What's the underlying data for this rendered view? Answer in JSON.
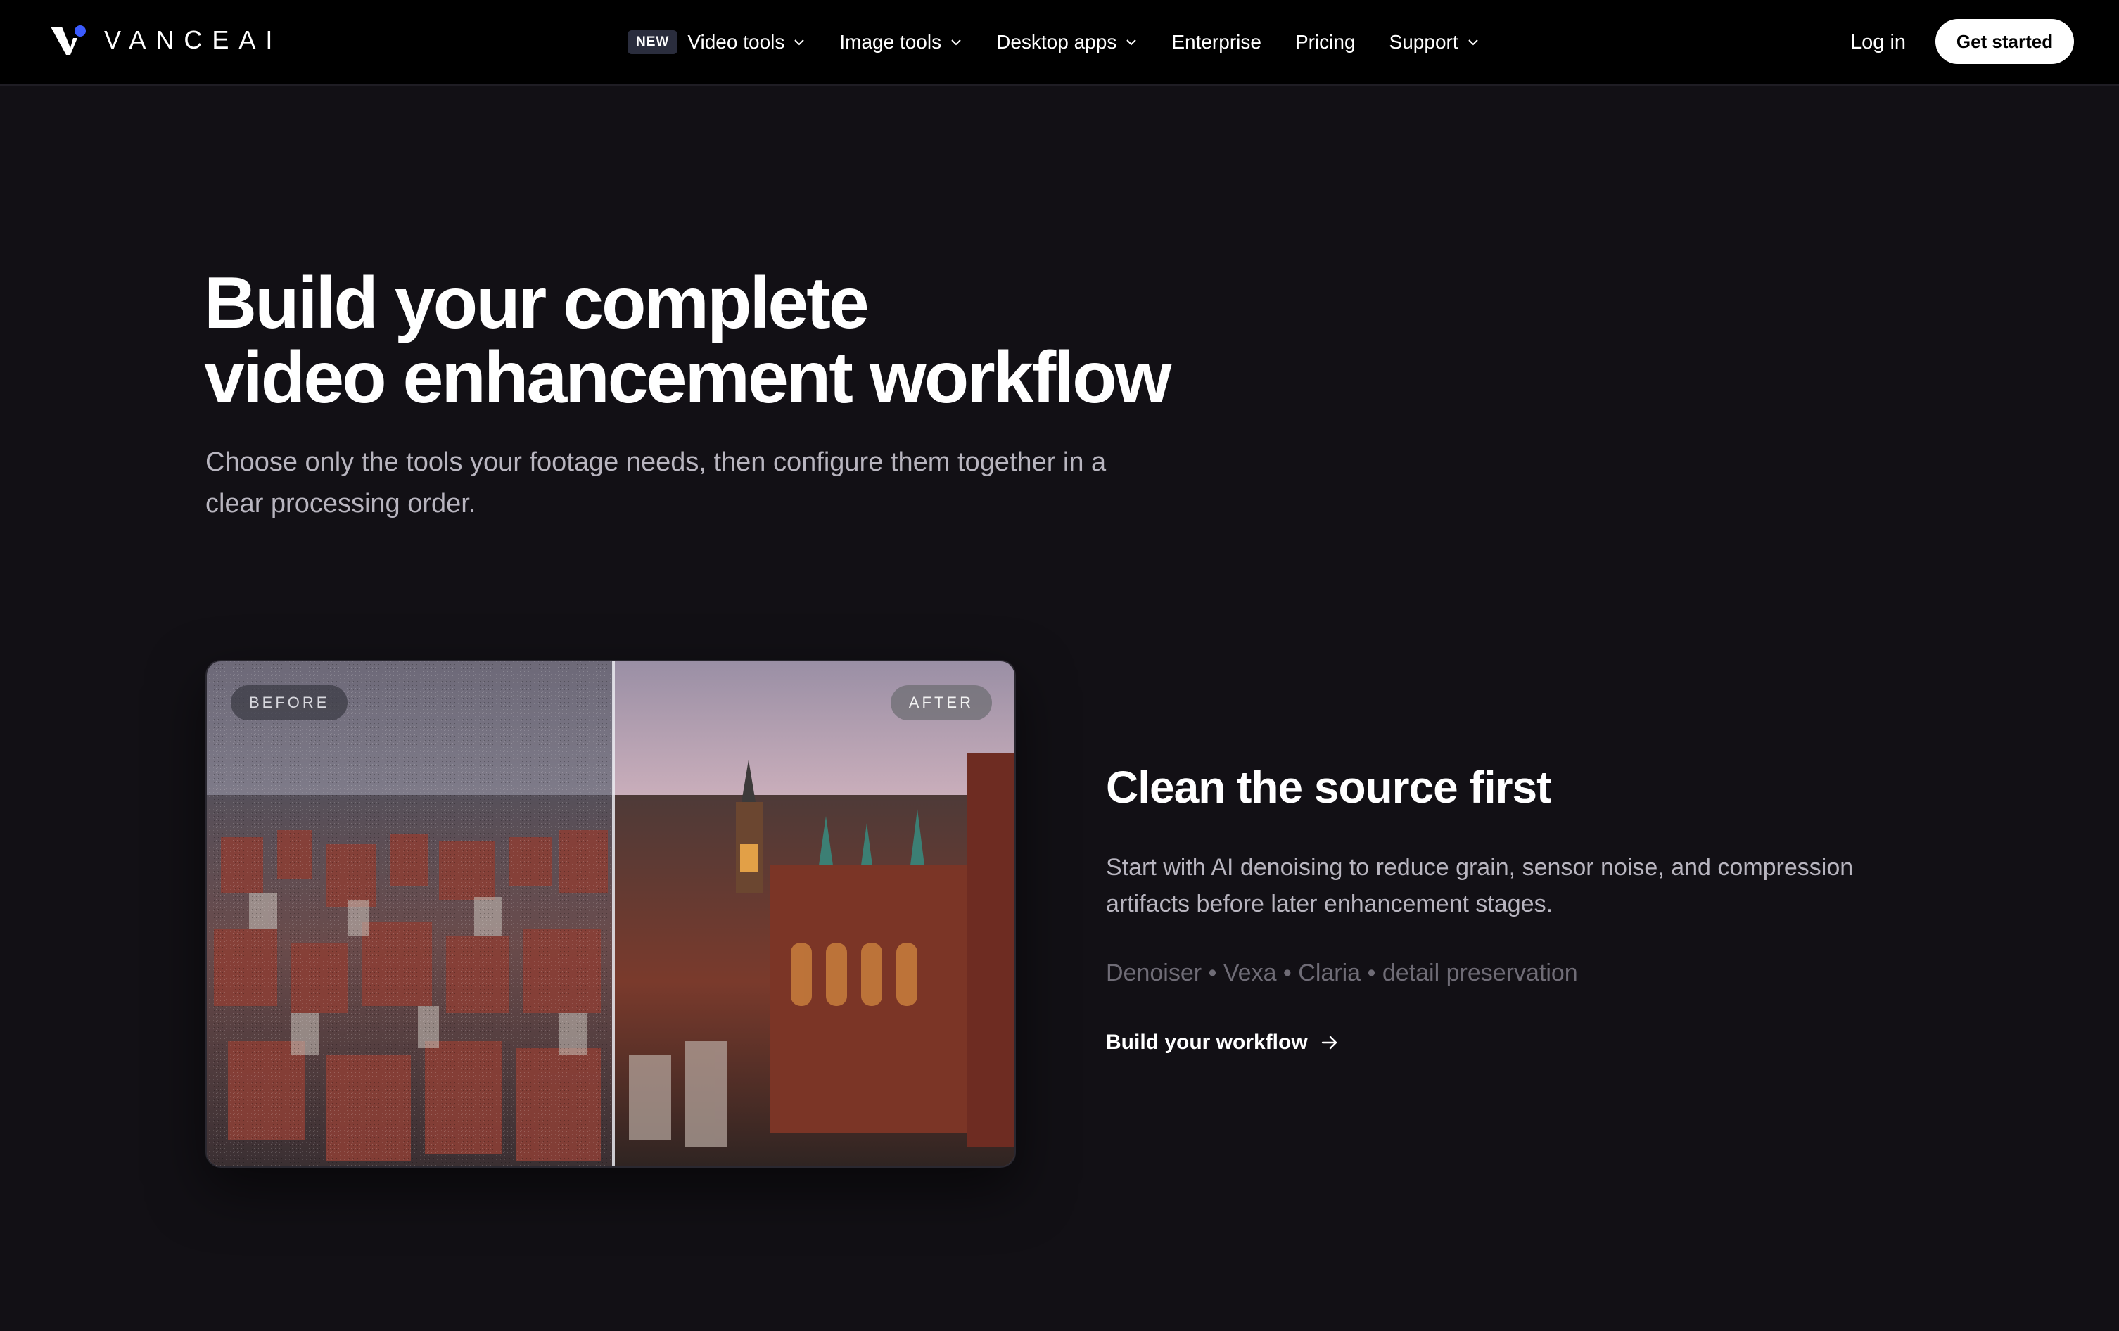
{
  "brand": {
    "name": "VANCEAI"
  },
  "nav": {
    "items": [
      {
        "label": "Video tools",
        "badge": "NEW",
        "has_dropdown": true
      },
      {
        "label": "Image tools",
        "has_dropdown": true
      },
      {
        "label": "Desktop apps",
        "has_dropdown": true
      },
      {
        "label": "Enterprise",
        "has_dropdown": false
      },
      {
        "label": "Pricing",
        "has_dropdown": false
      },
      {
        "label": "Support",
        "has_dropdown": true
      }
    ],
    "login_label": "Log in",
    "cta_label": "Get started"
  },
  "hero": {
    "title_line1": "Build your complete",
    "title_line2": "video enhancement workflow",
    "subtitle": "Choose only the tools your footage needs, then configure them together in a clear processing order."
  },
  "compare": {
    "before_label": "BEFORE",
    "after_label": "AFTER"
  },
  "feature": {
    "title": "Clean the source first",
    "description": "Start with AI denoising to reduce grain, sensor noise, and compression artifacts before later enhancement stages.",
    "tags": "Denoiser • Vexa • Claria • detail preservation",
    "link_label": "Build your workflow"
  },
  "colors": {
    "background": "#121015",
    "nav_background": "#000000",
    "logo_accent": "#3b5bff",
    "muted_text": "#b8b5bf",
    "tag_text": "#6f6c76"
  }
}
